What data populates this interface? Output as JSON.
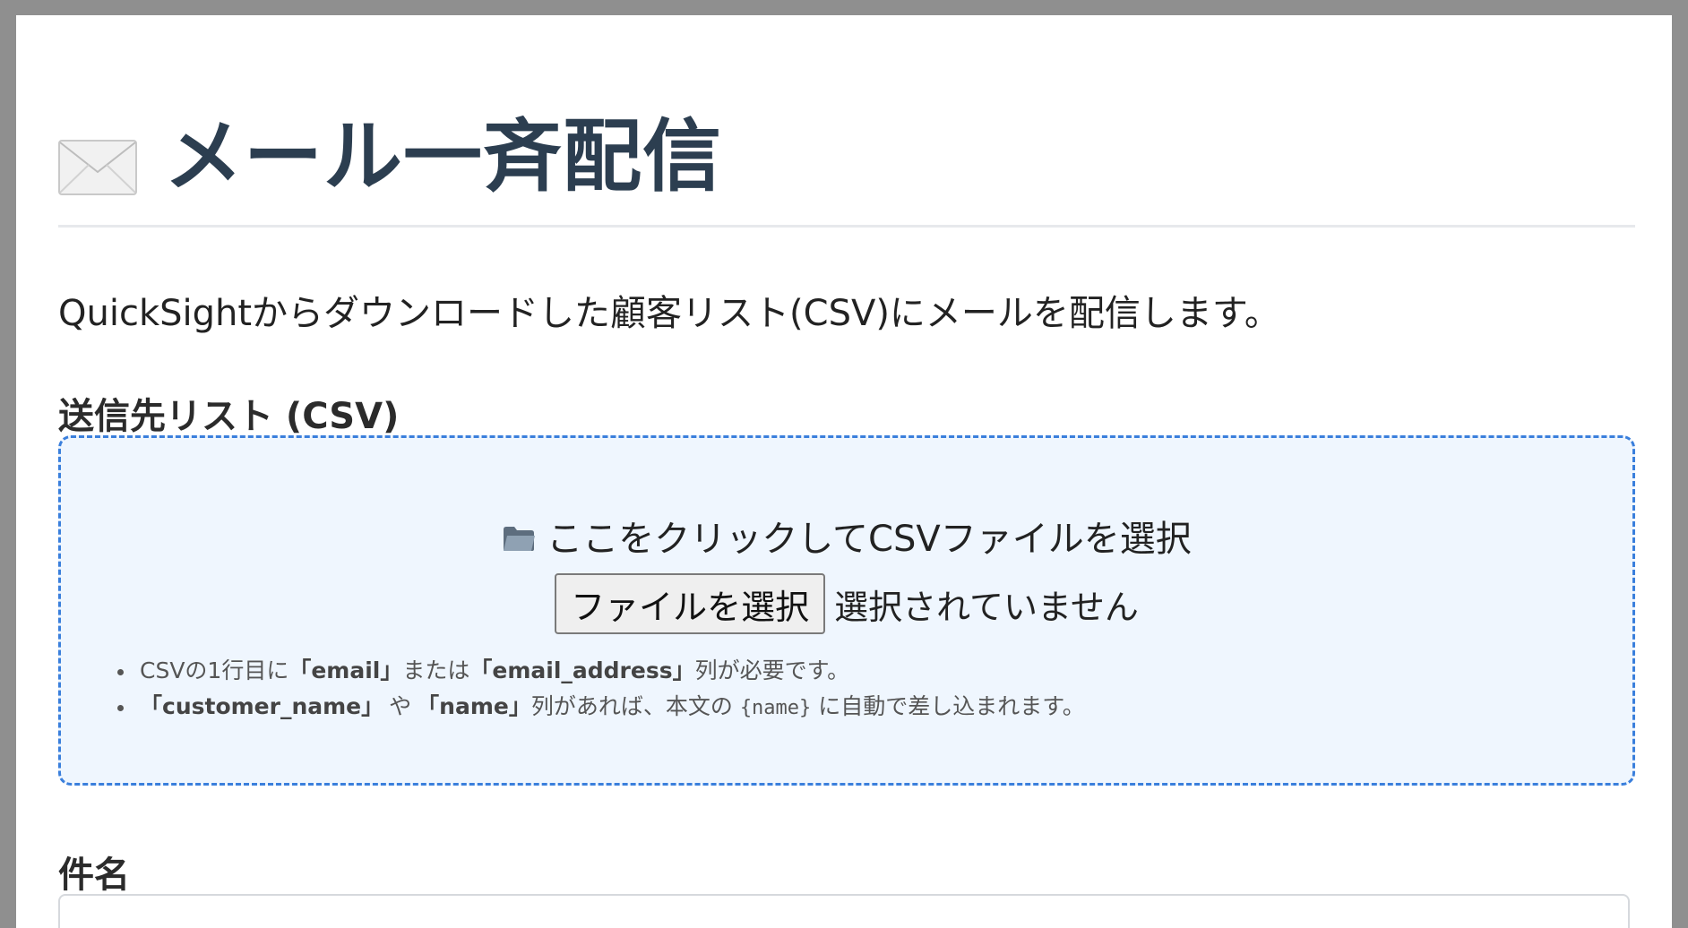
{
  "header": {
    "icon": "envelope-icon",
    "title": "メール一斉配信"
  },
  "description": "QuickSightからダウンロードした顧客リスト(CSV)にメールを配信します。",
  "csv_section": {
    "heading": "送信先リスト (CSV)",
    "dropzone": {
      "icon": "folder-icon",
      "prompt": "ここをクリックしてCSVファイルを選択",
      "file_button_label": "ファイルを選択",
      "file_status": "選択されていません",
      "accent_color": "#3a7fdc",
      "background_color": "#eff6fe"
    },
    "hints": [
      {
        "t1": "CSVの1行目に",
        "b1": "「email」",
        "t2": "または",
        "b2": "「email_address」",
        "t3": "列が必要です。"
      },
      {
        "b1": "「customer_name」",
        "t1": "や",
        "b2": "「name」",
        "t2": "列があれば、本文の",
        "code": "{name}",
        "t3": "に自動で差し込まれます。"
      }
    ]
  },
  "subject_section": {
    "heading": "件名",
    "input_value": "",
    "input_placeholder": ""
  },
  "colors": {
    "title": "#2c3e50",
    "frame": "#8f8f8f"
  }
}
